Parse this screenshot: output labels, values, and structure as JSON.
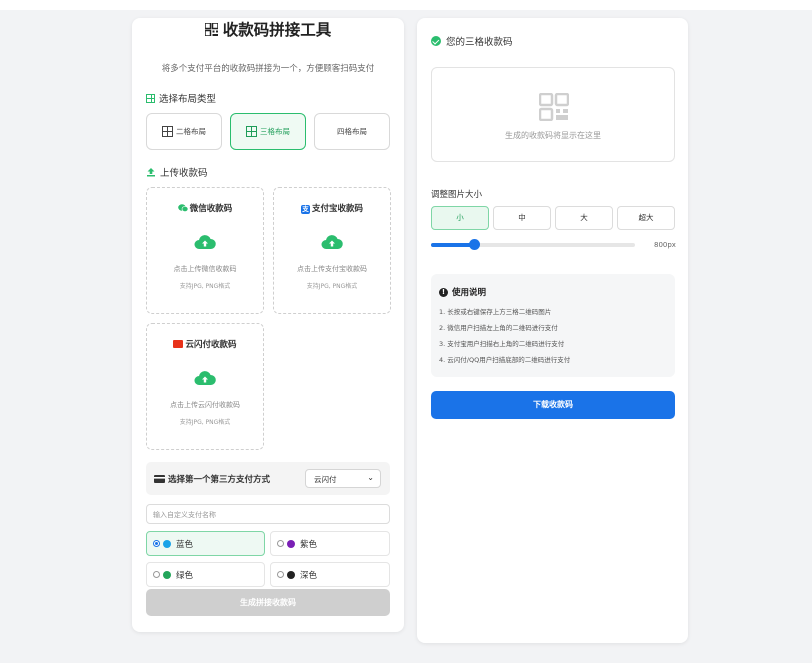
{
  "app": {
    "title": "收款码拼接工具",
    "subtitle": "将多个支付平台的收款码拼接为一个，方便顾客扫码支付"
  },
  "layout": {
    "section_label": "选择布局类型",
    "options": [
      {
        "label": "二格布局",
        "active": false
      },
      {
        "label": "三格布局",
        "active": true
      },
      {
        "label": "四格布局",
        "active": false
      }
    ]
  },
  "upload": {
    "section_label": "上传收款码",
    "boxes": [
      {
        "title": "微信收款码",
        "hint": "点击上传微信收款码",
        "formats": "支持JPG, PNG格式"
      },
      {
        "title": "支付宝收款码",
        "hint": "点击上传支付宝收款码",
        "formats": "支持JPG, PNG格式"
      },
      {
        "title": "云闪付收款码",
        "hint": "点击上传云闪付收款码",
        "formats": "支持JPG, PNG格式"
      }
    ]
  },
  "third_party": {
    "label": "选择第一个第三方支付方式",
    "selected": "云闪付"
  },
  "custom_name": {
    "placeholder": "输入自定义支付名称"
  },
  "colors": {
    "options": [
      {
        "label": "蓝色",
        "color": "#1aa3e8",
        "selected": true
      },
      {
        "label": "紫色",
        "color": "#7a1fb5",
        "selected": false
      },
      {
        "label": "绿色",
        "color": "#23a55a",
        "selected": false
      },
      {
        "label": "深色",
        "color": "#222222",
        "selected": false
      }
    ]
  },
  "generate_button": "生成拼接收款码",
  "result": {
    "header": "您的三格收款码",
    "placeholder": "生成的收款码将显示在这里"
  },
  "size": {
    "label": "调整图片大小",
    "options": [
      {
        "label": "小",
        "active": true
      },
      {
        "label": "中",
        "active": false
      },
      {
        "label": "大",
        "active": false
      },
      {
        "label": "超大",
        "active": false
      }
    ],
    "slider_fraction": 0.21,
    "value_text": "800px"
  },
  "instructions": {
    "title": "使用说明",
    "items": [
      "1. 长按或右键保存上方三格二维码图片",
      "2. 微信用户扫描左上角的二维码进行支付",
      "3. 支付宝用户扫描右上角的二维码进行支付",
      "4. 云闪付/QQ用户扫描底部的二维码进行支付"
    ]
  },
  "download_button": "下载收款码",
  "theme": {
    "green": "#2bbd6e",
    "blue": "#1a73e8"
  }
}
